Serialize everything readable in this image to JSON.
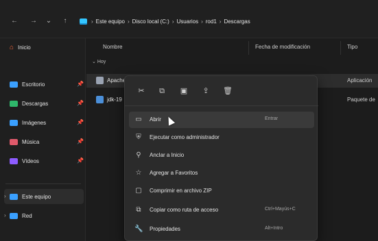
{
  "address": {
    "crumbs": [
      "Este equipo",
      "Disco local (C:)",
      "Usuarios",
      "rod1",
      "Descargas"
    ]
  },
  "sidebar": {
    "items": [
      {
        "label": "Inicio",
        "color": "#ffffff"
      },
      {
        "label": "Escritorio",
        "color": "#3aa0ff"
      },
      {
        "label": "Descargas",
        "color": "#2fb86b"
      },
      {
        "label": "Imágenes",
        "color": "#3aa0ff"
      },
      {
        "label": "Música",
        "color": "#e05a6b"
      },
      {
        "label": "Vídeos",
        "color": "#8d5cff"
      },
      {
        "label": "Este equipo",
        "color": "#3aa0ff"
      },
      {
        "label": "Red",
        "color": "#3aa0ff"
      }
    ]
  },
  "columns": {
    "name": "Nombre",
    "modified": "Fecha de modificación",
    "type": "Tipo"
  },
  "group": {
    "label": "Hoy"
  },
  "files": [
    {
      "name": "Apache",
      "type": "Aplicación"
    },
    {
      "name": "jdk-19",
      "type": "Paquete de"
    }
  ],
  "context_menu": {
    "toolbar": [
      "cut",
      "copy",
      "rename",
      "share",
      "delete"
    ],
    "items": [
      {
        "label": "Abrir",
        "shortcut": "Entrar"
      },
      {
        "label": "Ejecutar como administrador",
        "shortcut": ""
      },
      {
        "label": "Anclar a Inicio",
        "shortcut": ""
      },
      {
        "label": "Agregar a Favoritos",
        "shortcut": ""
      },
      {
        "label": "Comprimir en archivo ZIP",
        "shortcut": ""
      },
      {
        "label": "Copiar como ruta de acceso",
        "shortcut": "Ctrl+Mayús+C"
      },
      {
        "label": "Propiedades",
        "shortcut": "Alt+Intro"
      }
    ]
  }
}
